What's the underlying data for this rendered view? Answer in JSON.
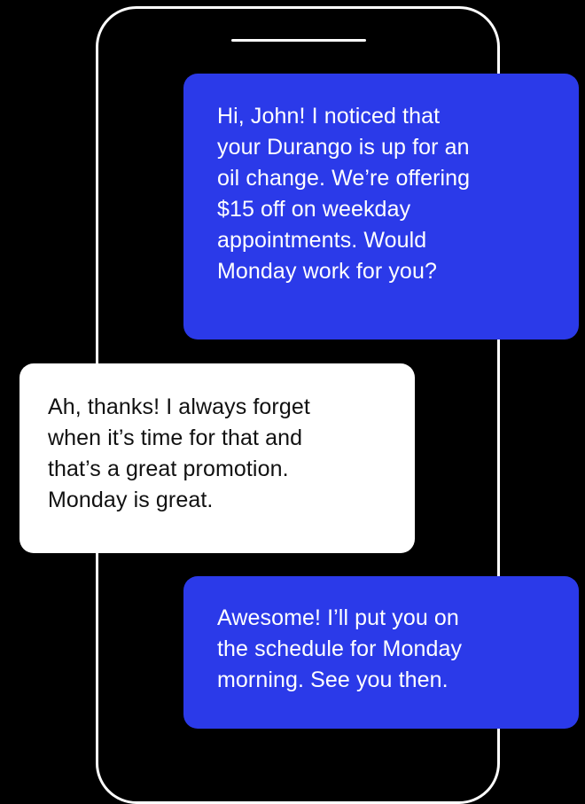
{
  "conversation": {
    "messages": [
      {
        "sender": "outgoing",
        "text": "Hi, John! I noticed that\nyour Durango is up for an\noil change. We’re offering\n$15 off on weekday\nappointments. Would\nMonday work for you?"
      },
      {
        "sender": "incoming",
        "text": "Ah, thanks! I always forget\nwhen it’s time for that and\nthat’s a great promotion.\nMonday is great."
      },
      {
        "sender": "outgoing",
        "text": "Awesome! I’ll put you on\nthe schedule for Monday\nmorning. See you then."
      }
    ]
  },
  "colors": {
    "background": "#000000",
    "outgoing_bubble": "#2b3ae9",
    "incoming_bubble": "#ffffff",
    "phone_outline": "#ffffff"
  }
}
